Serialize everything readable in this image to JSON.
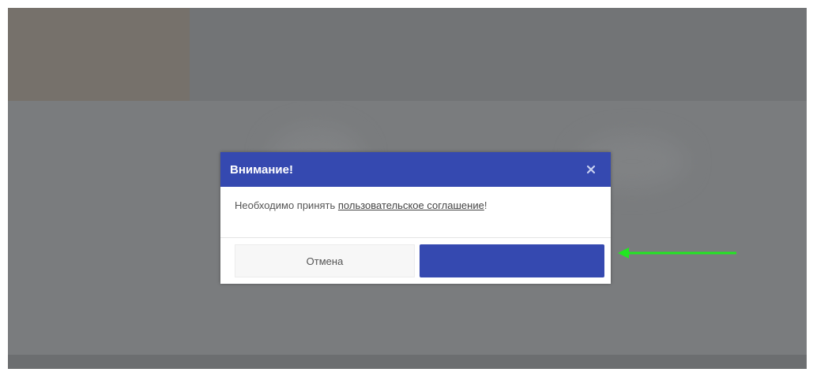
{
  "dialog": {
    "title": "Внимание!",
    "message_prefix": "Необходимо принять ",
    "agreement_link": "пользовательское соглашение",
    "message_suffix": "!",
    "cancel_label": "Отмена",
    "accept_label": ""
  },
  "icons": {
    "close": "close-icon",
    "annotation": "arrow-annotation-icon"
  },
  "colors": {
    "header": "#3549b0",
    "primary_button": "#3549b0",
    "overlay": "#7a7c7e",
    "annotation_arrow": "#22e622"
  }
}
